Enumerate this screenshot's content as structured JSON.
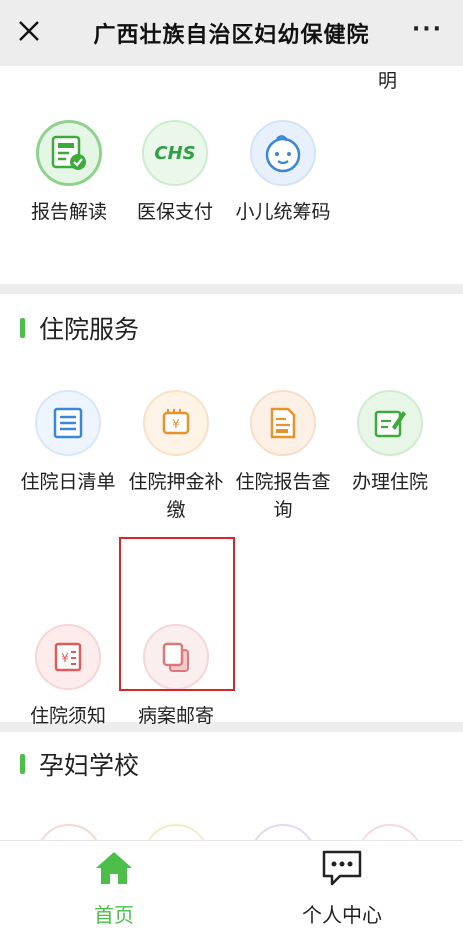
{
  "topbar": {
    "title": "广西壮族自治区妇幼保健院",
    "more": "···"
  },
  "clipped_text": "明",
  "section1": {
    "items": [
      {
        "label": "报告解读",
        "icon": "report-icon"
      },
      {
        "label": "医保支付",
        "icon": "chs-icon",
        "badge": "CHS"
      },
      {
        "label": "小儿统筹码",
        "icon": "baby-face-icon"
      }
    ]
  },
  "section2": {
    "title": "住院服务",
    "items": [
      {
        "label": "住院日清单",
        "icon": "list-icon"
      },
      {
        "label": "住院押金补缴",
        "icon": "deposit-icon"
      },
      {
        "label": "住院报告查询",
        "icon": "report-query-icon"
      },
      {
        "label": "办理住院",
        "icon": "admission-icon"
      },
      {
        "label": "住院须知",
        "icon": "notice-icon"
      },
      {
        "label": "病案邮寄",
        "icon": "record-mail-icon"
      }
    ]
  },
  "section3": {
    "title": "孕妇学校"
  },
  "tabbar": {
    "home": "首页",
    "personal": "个人中心"
  },
  "colors": {
    "accent": "#4cbf4a",
    "highlight": "#d9252a"
  }
}
